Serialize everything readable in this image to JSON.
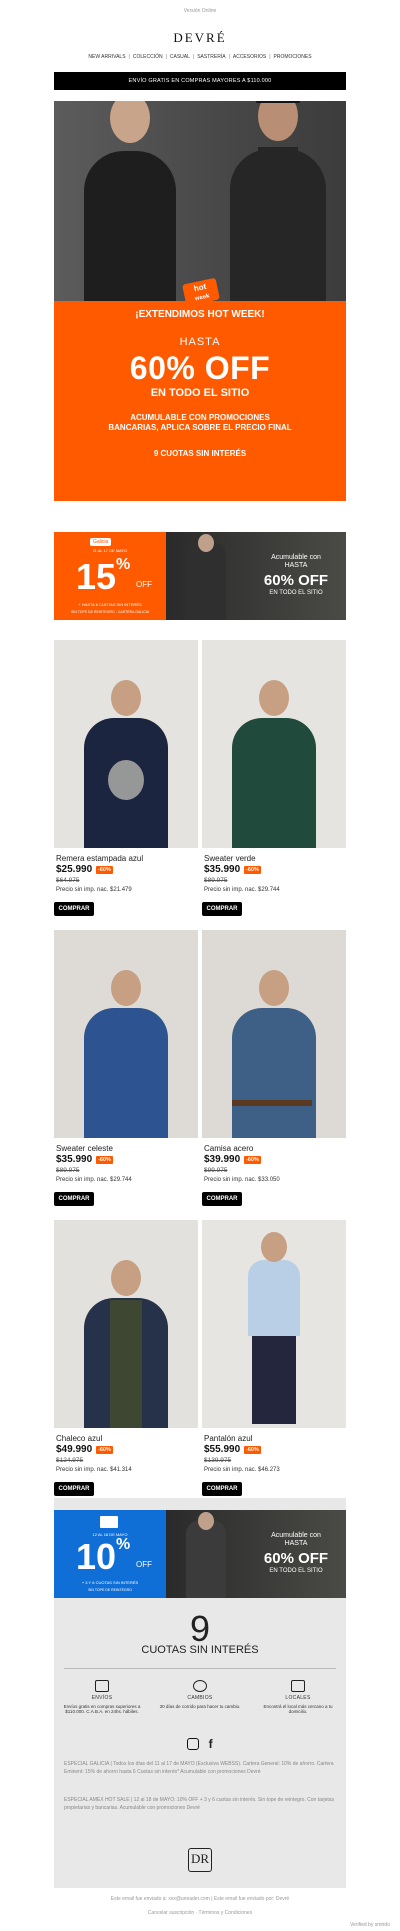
{
  "header": {
    "web_version": "Versión Online",
    "logo": "DEVRÉ",
    "nav": [
      "NEW ARRIVALS",
      "COLECCIÓN",
      "CASUAL",
      "SASTRERÍA",
      "ACCESORIOS",
      "PROMOCIONES"
    ],
    "shipping": "ENVÍO GRATIS EN COMPRAS MAYORES A $110.000"
  },
  "hero": {
    "sticker_line1": "hot",
    "sticker_line2": "week",
    "extend": "¡EXTENDIMOS HOT WEEK!",
    "hasta": "HASTA",
    "discount": "60% OFF",
    "site": "EN TODO EL SITIO",
    "acumulable_1": "ACUMULABLE CON PROMOCIONES",
    "acumulable_2": "BANCARIAS, APLICA SOBRE EL PRECIO FINAL",
    "cuotas": "9 CUOTAS SIN INTERÉS"
  },
  "banner1": {
    "bank": "Galicia",
    "until": "11 AL 17 DE MAYO",
    "pct": "15",
    "off": "OFF",
    "cuotas": "+ HASTA 6 CUOTAS SIN INTERÉS",
    "tope": "SIN TOPE DE REINTEGRO - CARTERA GALICIA",
    "acumulable": "Acumulable con",
    "hasta": "HASTA",
    "discount": "60% OFF",
    "site": "EN TODO EL SITIO"
  },
  "products": [
    {
      "name": "Remera estampada azul",
      "price": "$25.990",
      "badge": "-60%",
      "old": "$64.975",
      "net": "Precio sin imp. nac. $21.479",
      "buy": "COMPRAR"
    },
    {
      "name": "Sweater verde",
      "price": "$35.990",
      "badge": "-60%",
      "old": "$89.975",
      "net": "Precio sin imp. nac. $29.744",
      "buy": "COMPRAR"
    },
    {
      "name": "Sweater celeste",
      "price": "$35.990",
      "badge": "-60%",
      "old": "$89.975",
      "net": "Precio sin imp. nac. $29.744",
      "buy": "COMPRAR"
    },
    {
      "name": "Camisa acero",
      "price": "$39.990",
      "badge": "-60%",
      "old": "$99.975",
      "net": "Precio sin imp. nac. $33.050",
      "buy": "COMPRAR"
    },
    {
      "name": "Chaleco azul",
      "price": "$49.990",
      "badge": "-60%",
      "old": "$124.975",
      "net": "Precio sin imp. nac. $41.314",
      "buy": "COMPRAR"
    },
    {
      "name": "Pantalón azul",
      "price": "$55.990",
      "badge": "-60%",
      "old": "$139.975",
      "net": "Precio sin imp. nac. $46.273",
      "buy": "COMPRAR"
    }
  ],
  "banner2": {
    "until": "12 AL 18 DE MAYO",
    "pct": "10",
    "off": "OFF",
    "cuotas": "+ 3 Y 6 CUOTAS SIN INTERÉS",
    "tope": "SIN TOPE DE REINTEGRO",
    "acumulable": "Acumulable con",
    "hasta": "HASTA",
    "discount": "60% OFF",
    "site": "EN TODO EL SITIO"
  },
  "benefits": {
    "nine": "9",
    "cuotas": "CUOTAS SIN INTERÉS",
    "items": [
      {
        "title": "ENVÍOS",
        "text": "Envíos gratis en compras superiores a $110.000. C.A.B.A. en 24hs. hábiles."
      },
      {
        "title": "CAMBIOS",
        "text": "30 días de corrido para hacer tu cambio."
      },
      {
        "title": "LOCALES",
        "text": "Encontrá el local más cercano a tu domicilio."
      }
    ],
    "fine1": "ESPECIAL GALICIA | Todos los días del 11 al 17 de MAYO (Exclusiva WEBSS). Cartera General: 10% de ahorro. Cartera Eminent: 15% de ahorro hasta 6 Cuotas sin interés* Acumulable con promociones Devré",
    "fine2": "ESPECIAL AMEX HOT SALE | 12 al 18 de MAYO: 10% OFF + 3 y 6 cuotas sin interés. Sin tope de reintegro. Con tarjetas propietarias y bancarias. Acumulable con promociones Devré",
    "logo": "DR"
  },
  "footer": {
    "line1": "Este email fue enviado a: xxx@uneader.com | Este email fue enviado por: Devré",
    "line2": "Cancelar suscripción · Términos y Condiciones",
    "verified": "Verified by smtrdo"
  },
  "colors": {
    "accent": "#ff5a00",
    "amex_blue": "#0f6fd6",
    "dark": "#000000"
  }
}
